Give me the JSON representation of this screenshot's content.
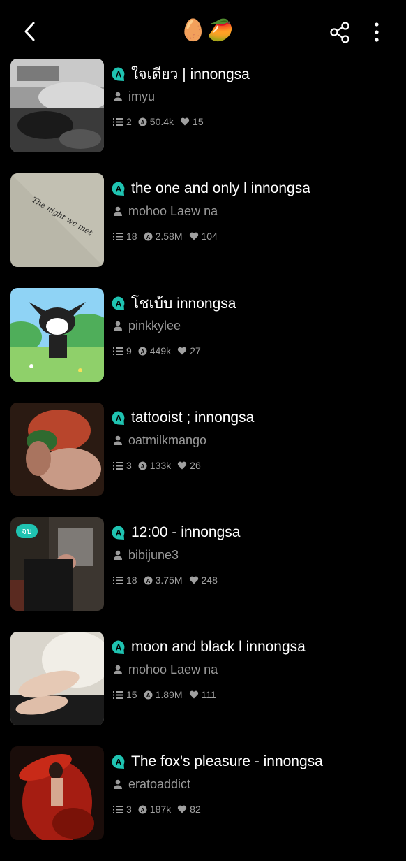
{
  "header": {
    "title_emoji": "🥚🥭",
    "back_icon": "chevron-left-icon",
    "share_icon": "share-icon",
    "more_icon": "more-vertical-icon"
  },
  "colors": {
    "accent": "#1fc3b1",
    "background": "#000000",
    "muted": "#9a9a9a"
  },
  "stories": [
    {
      "title": "ใจเดียว | innongsa",
      "author": "imyu",
      "parts": "2",
      "reads": "50.4k",
      "votes": "15",
      "badge": ""
    },
    {
      "title": "the one and only l innongsa",
      "author": "mohoo Laew na",
      "parts": "18",
      "reads": "2.58M",
      "votes": "104",
      "badge": ""
    },
    {
      "title": "โชเบ้บ innongsa",
      "author": "pinkkylee",
      "parts": "9",
      "reads": "449k",
      "votes": "27",
      "badge": ""
    },
    {
      "title": "tattooist ; innongsa",
      "author": "oatmilkmango",
      "parts": "3",
      "reads": "133k",
      "votes": "26",
      "badge": ""
    },
    {
      "title": "12:00 - innongsa",
      "author": "bibijune3",
      "parts": "18",
      "reads": "3.75M",
      "votes": "248",
      "badge": "จบ"
    },
    {
      "title": "moon and black l innongsa",
      "author": "mohoo Laew na",
      "parts": "15",
      "reads": "1.89M",
      "votes": "111",
      "badge": ""
    },
    {
      "title": "The fox's pleasure - innongsa",
      "author": "eratoaddict",
      "parts": "3",
      "reads": "187k",
      "votes": "82",
      "badge": ""
    }
  ]
}
